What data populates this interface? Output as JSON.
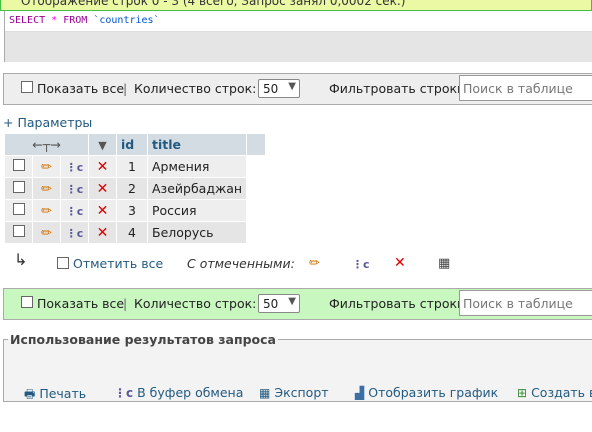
{
  "banner": {
    "text": "Отображение строк 0 - 3 (4 всего, Запрос занял 0,0002 сек.)"
  },
  "sql": {
    "select": "SELECT",
    "star": "*",
    "from": "FROM",
    "table": "`countries`"
  },
  "nav_top": {
    "show_all": "Показать все",
    "row_count_label": "Количество строк:",
    "row_count_value": "50",
    "filter_label": "Фильтровать строки:",
    "search_placeholder": "Поиск в таблице"
  },
  "params_link": "+ Параметры",
  "table": {
    "columns": [
      "id",
      "title"
    ],
    "rows": [
      {
        "id": "1",
        "title": "Армения"
      },
      {
        "id": "2",
        "title": "Азейрбаджан"
      },
      {
        "id": "3",
        "title": "Россия"
      },
      {
        "id": "4",
        "title": "Белорусь"
      }
    ]
  },
  "bulk": {
    "check_all": "Отметить все",
    "with_selected": "С отмеченными:"
  },
  "nav_bottom": {
    "show_all": "Показать все",
    "row_count_label": "Количество строк:",
    "row_count_value": "50",
    "filter_label": "Фильтровать строки:",
    "search_placeholder": "Поиск в таблице"
  },
  "usage": {
    "legend": "Использование результатов запроса",
    "print": "Печать",
    "clipboard": "В буфер обмена",
    "export": "Экспорт",
    "chart": "Отобразить график",
    "create": "Создать в"
  },
  "colors": {
    "link": "#235a81",
    "header_bg": "#d3dce3",
    "banner_border": "#3fc23f",
    "bottom_nav_bg": "#c9f7c0"
  }
}
